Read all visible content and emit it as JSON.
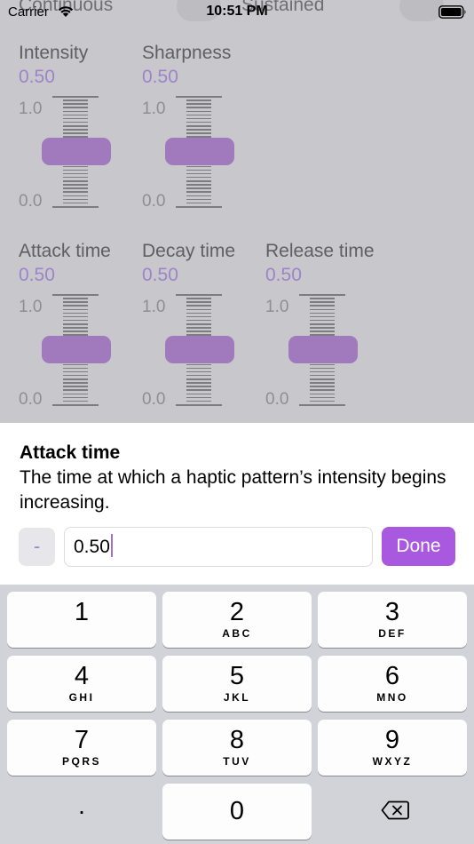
{
  "status_bar": {
    "carrier": "Carrier",
    "time": "10:51 PM"
  },
  "toggles": {
    "left_label": "Continuous",
    "right_label": "Sustained"
  },
  "sliders": [
    {
      "title": "Intensity",
      "value": "0.50",
      "max_label": "1.0",
      "min_label": "0.0",
      "level": 0.5
    },
    {
      "title": "Sharpness",
      "value": "0.50",
      "max_label": "1.0",
      "min_label": "0.0",
      "level": 0.5
    },
    {
      "title": "Attack time",
      "value": "0.50",
      "max_label": "1.0",
      "min_label": "0.0",
      "level": 0.5
    },
    {
      "title": "Decay time",
      "value": "0.50",
      "max_label": "1.0",
      "min_label": "0.0",
      "level": 0.5
    },
    {
      "title": "Release time",
      "value": "0.50",
      "max_label": "1.0",
      "min_label": "0.0",
      "level": 0.5
    }
  ],
  "editor": {
    "title": "Attack time",
    "description": "The time at which a haptic pattern’s intensity begins increasing.",
    "minus_label": "-",
    "field_value": "0.50",
    "done_label": "Done"
  },
  "keypad": {
    "keys": [
      {
        "digit": "1",
        "letters": ""
      },
      {
        "digit": "2",
        "letters": "ABC"
      },
      {
        "digit": "3",
        "letters": "DEF"
      },
      {
        "digit": "4",
        "letters": "GHI"
      },
      {
        "digit": "5",
        "letters": "JKL"
      },
      {
        "digit": "6",
        "letters": "MNO"
      },
      {
        "digit": "7",
        "letters": "PQRS"
      },
      {
        "digit": "8",
        "letters": "TUV"
      },
      {
        "digit": "9",
        "letters": "WXYZ"
      }
    ],
    "decimal": ".",
    "zero": "0",
    "delete_icon": "delete-backward-icon"
  },
  "colors": {
    "accent": "#a959df",
    "slider_thumb": "#a07abd",
    "value_text": "#9d84c9",
    "dimmed_background": "#c8c7cc"
  }
}
